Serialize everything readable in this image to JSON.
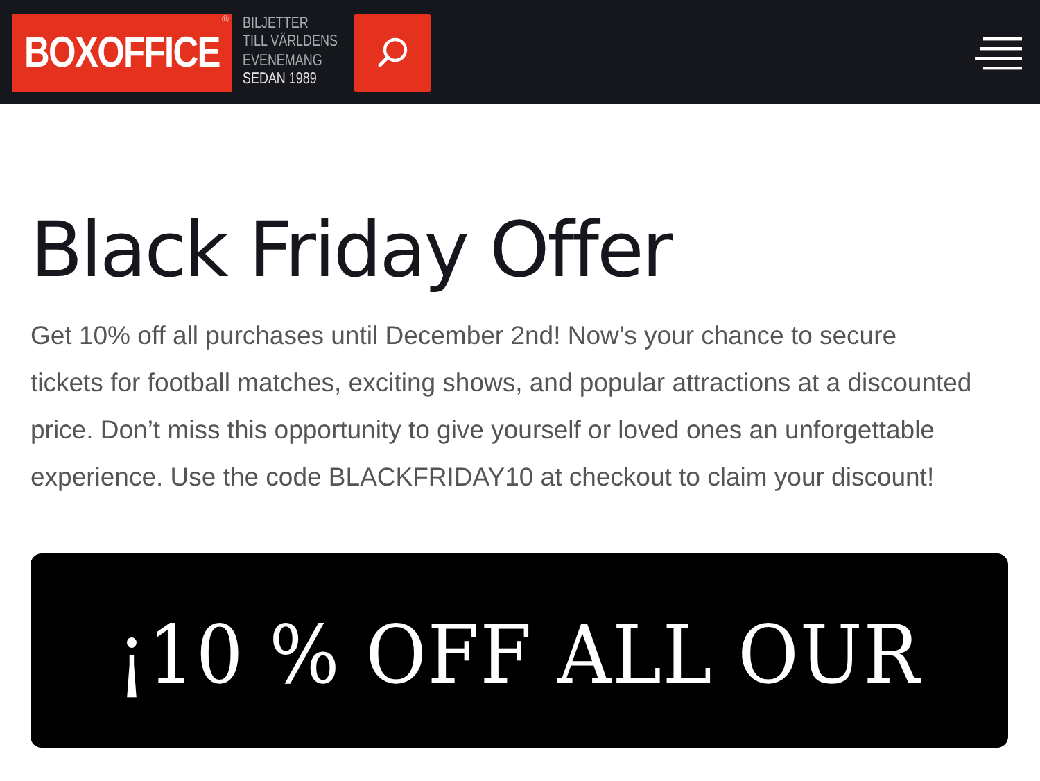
{
  "header": {
    "logo": "BOXOFFICE",
    "registered": "®",
    "tagline": [
      "BILJETTER",
      "TILL VÄRLDENS",
      "EVENEMANG",
      "SEDAN 1989"
    ]
  },
  "article": {
    "title": "Black Friday Offer",
    "body": "Get 10% off all purchases until December 2nd! Now’s your chance to secure tickets for football matches, exciting shows, and popular attractions at a discounted price. Don’t miss this opportunity to give yourself or loved ones an unforgettable experience. Use the code BLACKFRIDAY10 at checkout to claim your discount!"
  },
  "banner": {
    "headline": "¡10 % OFF ALL OUR"
  }
}
